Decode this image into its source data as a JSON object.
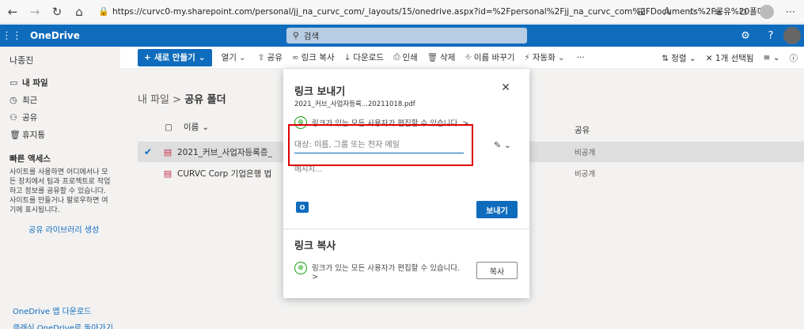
{
  "browser": {
    "url": "https://curvc0-my.sharepoint.com/personal/jj_na_curvc_com/_layouts/15/onedrive.aspx?id=%2Fpersonal%2Fjj_na_curvc_com%2FDocuments%2F공유%20폴더"
  },
  "header": {
    "app_name": "OneDrive",
    "search_placeholder": "검색"
  },
  "sidebar": {
    "user": "나종진",
    "items": [
      {
        "label": "내 파일"
      },
      {
        "label": "최근"
      },
      {
        "label": "공유"
      },
      {
        "label": "휴지통"
      }
    ],
    "quick_access": "빠른 액세스",
    "description": "사이트를 사용하면 어디에서나 모든 장치에서 팀과 프로젝트로 작업하고 정보를 공유할 수 있습니다. 사이트를 만들거나 팔로우하면 여기에 표시됩니다.",
    "create_link": "공유 라이브러리 생성",
    "download_app": "OneDrive 앱 다운로드",
    "classic": "클래식 OneDrive로 돌아가기"
  },
  "commandbar": {
    "new": "새로 만들기",
    "open": "열기",
    "share": "공유",
    "copy_link": "링크 복사",
    "download": "다운로드",
    "print": "인쇄",
    "delete": "삭제",
    "rename": "이름 바꾸기",
    "automate": "자동화",
    "more": "···",
    "sort": "정렬",
    "selected": "1개 선택됨"
  },
  "main": {
    "breadcrumb_root": "내 파일",
    "breadcrumb_current": "공유 폴더",
    "col_name": "이름",
    "col_sharing": "공유",
    "files": [
      {
        "name": "2021_커브_사업자등록증_202",
        "sharing": "비공개"
      },
      {
        "name": "CURVC Corp 기업은행 법인통",
        "sharing": "비공개"
      }
    ]
  },
  "dialog": {
    "title": "링크 보내기",
    "filename": "2021_커브_사업자등록...20211018.pdf",
    "permission": "링크가 있는 모든 사용자가 편집할 수 있습니다. >",
    "to_placeholder": "대상: 이름, 그룹 또는 전자 메일",
    "message_placeholder": "메시지...",
    "outlook_letter": "O",
    "send_label": "보내기",
    "copy_title": "링크 복사",
    "copy_permission": "링크가 있는 모든 사용자가 편집할 수 있습니다. >",
    "copy_label": "복사"
  }
}
